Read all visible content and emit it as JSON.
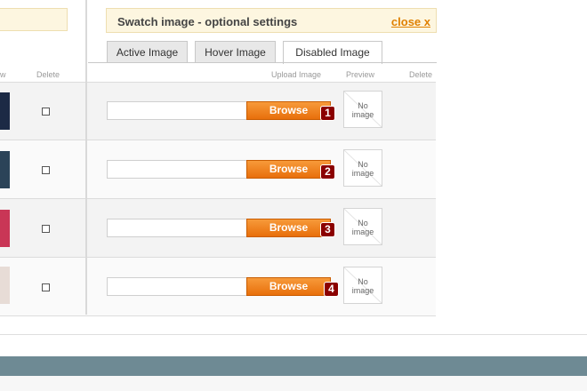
{
  "left_panel": {
    "col_preview_fragment": "w",
    "col_delete": "Delete",
    "swatch_colors": [
      "#1c2a45",
      "#2b4358",
      "#c93656",
      "#e7dcd6"
    ]
  },
  "swatch_settings": {
    "title": "Swatch image - optional settings",
    "close_label": "close x",
    "tabs": [
      {
        "label": "Active Image",
        "active": false
      },
      {
        "label": "Hover Image",
        "active": false
      },
      {
        "label": "Disabled Image",
        "active": true
      }
    ],
    "columns": {
      "upload": "Upload Image",
      "preview": "Preview",
      "delete": "Delete"
    },
    "rows": [
      {
        "browse_label": "Browse",
        "badge": "1",
        "preview_text": "No image"
      },
      {
        "browse_label": "Browse",
        "badge": "2",
        "preview_text": "No image"
      },
      {
        "browse_label": "Browse",
        "badge": "3",
        "preview_text": "No image"
      },
      {
        "browse_label": "Browse",
        "badge": "4",
        "preview_text": "No image"
      }
    ]
  },
  "colors": {
    "accent_orange": "#ef7f1a",
    "badge_red": "#8b0000",
    "footer_bar": "#6e8a94",
    "header_bg": "#fdf6e0"
  }
}
